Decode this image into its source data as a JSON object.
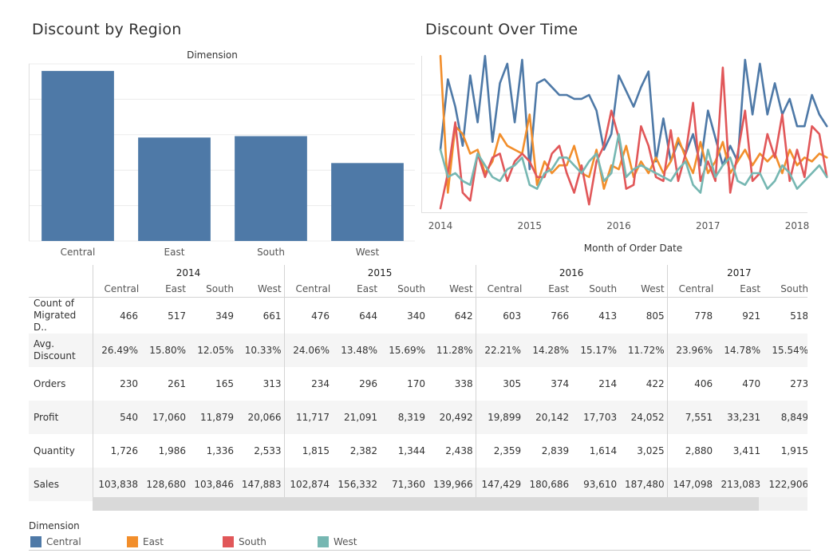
{
  "colors": {
    "Central": "#4e79a7",
    "East": "#f28e2b",
    "South": "#e15759",
    "West": "#76b7b2"
  },
  "chart_data": [
    {
      "type": "bar",
      "title": "Discount by Region",
      "header": "Dimension",
      "categories": [
        "Central",
        "East",
        "South",
        "West"
      ],
      "values": [
        0.24,
        0.146,
        0.148,
        0.11
      ],
      "ylim": [
        0,
        0.25
      ],
      "grid": true,
      "color": "#4e79a7"
    },
    {
      "type": "line",
      "title": "Discount Over Time",
      "xlabel": "Month of Order Date",
      "x_ticks": [
        "2014",
        "2015",
        "2016",
        "2017",
        "2018"
      ],
      "x_start": "2014-01",
      "ylim": [
        0,
        0.4
      ],
      "grid": true,
      "series": [
        {
          "name": "Central",
          "values": [
            0.16,
            0.34,
            0.27,
            0.17,
            0.35,
            0.23,
            0.4,
            0.18,
            0.33,
            0.38,
            0.23,
            0.39,
            0.11,
            0.33,
            0.34,
            0.32,
            0.3,
            0.3,
            0.29,
            0.29,
            0.3,
            0.26,
            0.16,
            0.2,
            0.35,
            0.31,
            0.27,
            0.32,
            0.36,
            0.13,
            0.24,
            0.13,
            0.18,
            0.15,
            0.2,
            0.12,
            0.26,
            0.19,
            0.12,
            0.17,
            0.13,
            0.39,
            0.25,
            0.38,
            0.25,
            0.33,
            0.25,
            0.29,
            0.22,
            0.22,
            0.3,
            0.25,
            0.22
          ]
        },
        {
          "name": "East",
          "values": [
            0.4,
            0.05,
            0.22,
            0.2,
            0.15,
            0.16,
            0.1,
            0.13,
            0.2,
            0.17,
            0.16,
            0.15,
            0.25,
            0.07,
            0.13,
            0.1,
            0.12,
            0.12,
            0.17,
            0.1,
            0.09,
            0.16,
            0.06,
            0.12,
            0.11,
            0.17,
            0.09,
            0.13,
            0.1,
            0.14,
            0.1,
            0.13,
            0.19,
            0.14,
            0.1,
            0.18,
            0.1,
            0.13,
            0.18,
            0.1,
            0.13,
            0.16,
            0.12,
            0.15,
            0.13,
            0.15,
            0.1,
            0.16,
            0.12,
            0.14,
            0.13,
            0.15,
            0.14
          ]
        },
        {
          "name": "South",
          "values": [
            0.01,
            0.1,
            0.23,
            0.05,
            0.03,
            0.15,
            0.09,
            0.14,
            0.15,
            0.08,
            0.13,
            0.15,
            0.13,
            0.09,
            0.09,
            0.15,
            0.17,
            0.1,
            0.05,
            0.12,
            0.02,
            0.13,
            0.17,
            0.26,
            0.19,
            0.06,
            0.07,
            0.22,
            0.17,
            0.09,
            0.08,
            0.21,
            0.08,
            0.15,
            0.28,
            0.08,
            0.13,
            0.08,
            0.37,
            0.05,
            0.15,
            0.26,
            0.08,
            0.1,
            0.2,
            0.14,
            0.25,
            0.08,
            0.16,
            0.09,
            0.22,
            0.2,
            0.09
          ]
        },
        {
          "name": "West",
          "values": [
            0.16,
            0.09,
            0.1,
            0.08,
            0.07,
            0.15,
            0.12,
            0.09,
            0.08,
            0.11,
            0.12,
            0.14,
            0.07,
            0.06,
            0.1,
            0.11,
            0.14,
            0.14,
            0.12,
            0.1,
            0.13,
            0.15,
            0.08,
            0.1,
            0.2,
            0.09,
            0.11,
            0.12,
            0.11,
            0.1,
            0.09,
            0.08,
            0.11,
            0.13,
            0.07,
            0.05,
            0.16,
            0.09,
            0.12,
            0.14,
            0.08,
            0.07,
            0.1,
            0.1,
            0.06,
            0.08,
            0.12,
            0.1,
            0.06,
            0.08,
            0.1,
            0.12,
            0.09
          ]
        }
      ]
    }
  ],
  "table": {
    "years": [
      "2014",
      "2015",
      "2016",
      "2017"
    ],
    "regions": [
      "Central",
      "East",
      "South",
      "West"
    ],
    "visible_regions_last_year": [
      "Central",
      "East",
      "South"
    ],
    "rows": [
      {
        "label": "Count of Migrated D..",
        "values": [
          [
            "466",
            "517",
            "349",
            "661"
          ],
          [
            "476",
            "644",
            "340",
            "642"
          ],
          [
            "603",
            "766",
            "413",
            "805"
          ],
          [
            "778",
            "921",
            "518"
          ]
        ]
      },
      {
        "label": "Avg. Discount",
        "values": [
          [
            "26.49%",
            "15.80%",
            "12.05%",
            "10.33%"
          ],
          [
            "24.06%",
            "13.48%",
            "15.69%",
            "11.28%"
          ],
          [
            "22.21%",
            "14.28%",
            "15.17%",
            "11.72%"
          ],
          [
            "23.96%",
            "14.78%",
            "15.54%"
          ]
        ]
      },
      {
        "label": "Orders",
        "values": [
          [
            "230",
            "261",
            "165",
            "313"
          ],
          [
            "234",
            "296",
            "170",
            "338"
          ],
          [
            "305",
            "374",
            "214",
            "422"
          ],
          [
            "406",
            "470",
            "273"
          ]
        ]
      },
      {
        "label": "Profit",
        "values": [
          [
            "540",
            "17,060",
            "11,879",
            "20,066"
          ],
          [
            "11,717",
            "21,091",
            "8,319",
            "20,492"
          ],
          [
            "19,899",
            "20,142",
            "17,703",
            "24,052"
          ],
          [
            "7,551",
            "33,231",
            "8,849"
          ]
        ]
      },
      {
        "label": "Quantity",
        "values": [
          [
            "1,726",
            "1,986",
            "1,336",
            "2,533"
          ],
          [
            "1,815",
            "2,382",
            "1,344",
            "2,438"
          ],
          [
            "2,359",
            "2,839",
            "1,614",
            "3,025"
          ],
          [
            "2,880",
            "3,411",
            "1,915"
          ]
        ]
      },
      {
        "label": "Sales",
        "values": [
          [
            "103,838",
            "128,680",
            "103,846",
            "147,883"
          ],
          [
            "102,874",
            "156,332",
            "71,360",
            "139,966"
          ],
          [
            "147,429",
            "180,686",
            "93,610",
            "187,480"
          ],
          [
            "147,098",
            "213,083",
            "122,906"
          ]
        ]
      }
    ]
  },
  "legend": {
    "title": "Dimension",
    "items": [
      "Central",
      "East",
      "South",
      "West"
    ]
  }
}
